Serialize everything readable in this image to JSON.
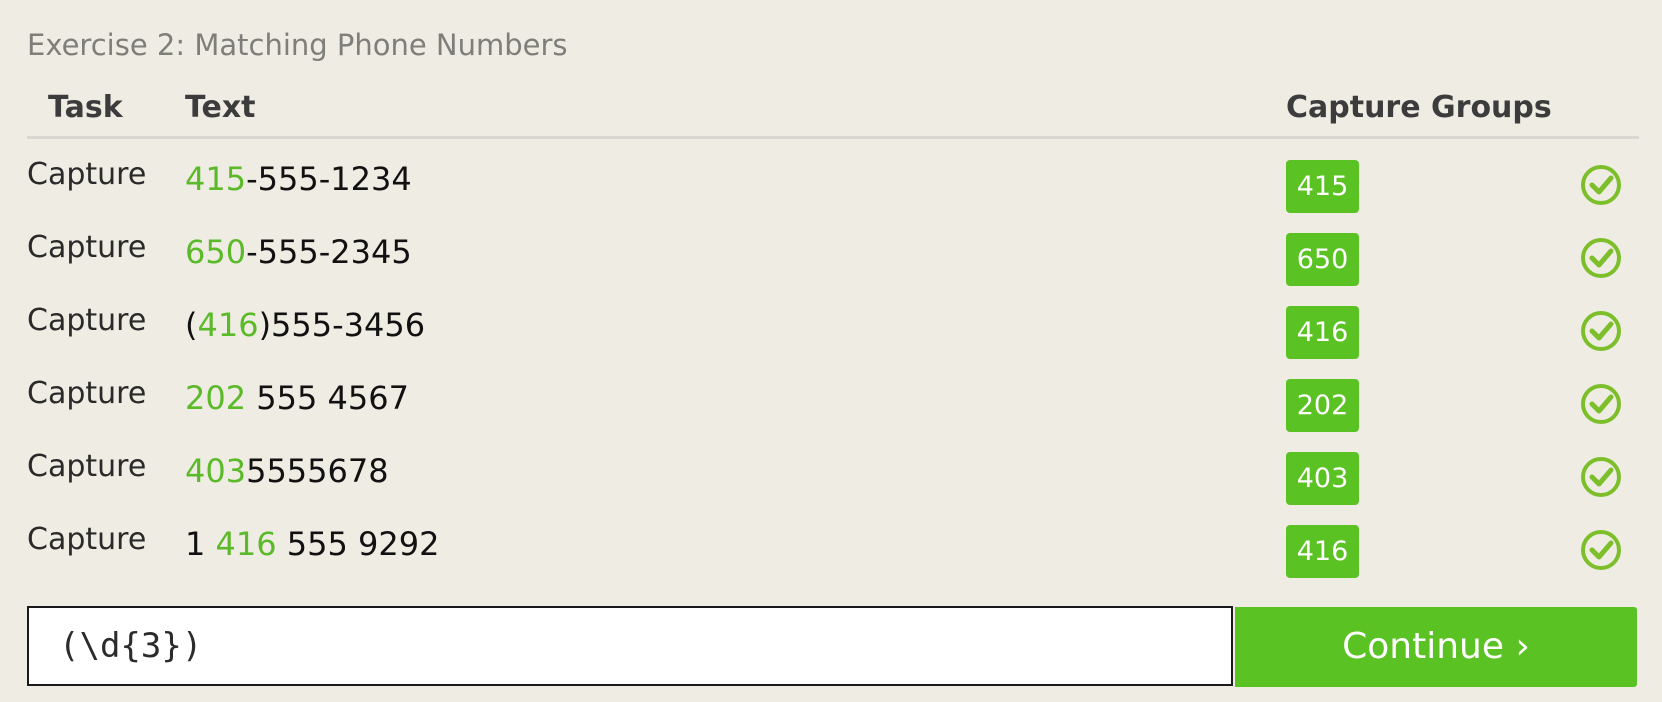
{
  "exercise_title": "Exercise 2: Matching Phone Numbers",
  "table": {
    "headers": {
      "task": "Task",
      "text": "Text",
      "capture_groups": "Capture Groups"
    },
    "rows": [
      {
        "task": "Capture",
        "pre": "",
        "match": "415",
        "post": "-555-1234",
        "group": "415",
        "status": "matched"
      },
      {
        "task": "Capture",
        "pre": "",
        "match": "650",
        "post": "-555-2345",
        "group": "650",
        "status": "matched"
      },
      {
        "task": "Capture",
        "pre": "(",
        "match": "416",
        "post": ")555-3456",
        "group": "416",
        "status": "matched"
      },
      {
        "task": "Capture",
        "pre": "",
        "match": "202",
        "post": " 555 4567",
        "group": "202",
        "status": "matched"
      },
      {
        "task": "Capture",
        "pre": "",
        "match": "403",
        "post": "5555678",
        "group": "403",
        "status": "matched"
      },
      {
        "task": "Capture",
        "pre": "1 ",
        "match": "416",
        "post": " 555 9292",
        "group": "416",
        "status": "matched"
      }
    ]
  },
  "regex_input": {
    "value": "(\\d{3})",
    "placeholder": ""
  },
  "continue_button": {
    "label": "Continue ›"
  },
  "colors": {
    "background": "#efece3",
    "accent_green": "#5bc223",
    "match_text_green": "#5bba29",
    "check_green": "#7cbf2b"
  },
  "icons": {
    "row_status": "check-circle-icon"
  }
}
